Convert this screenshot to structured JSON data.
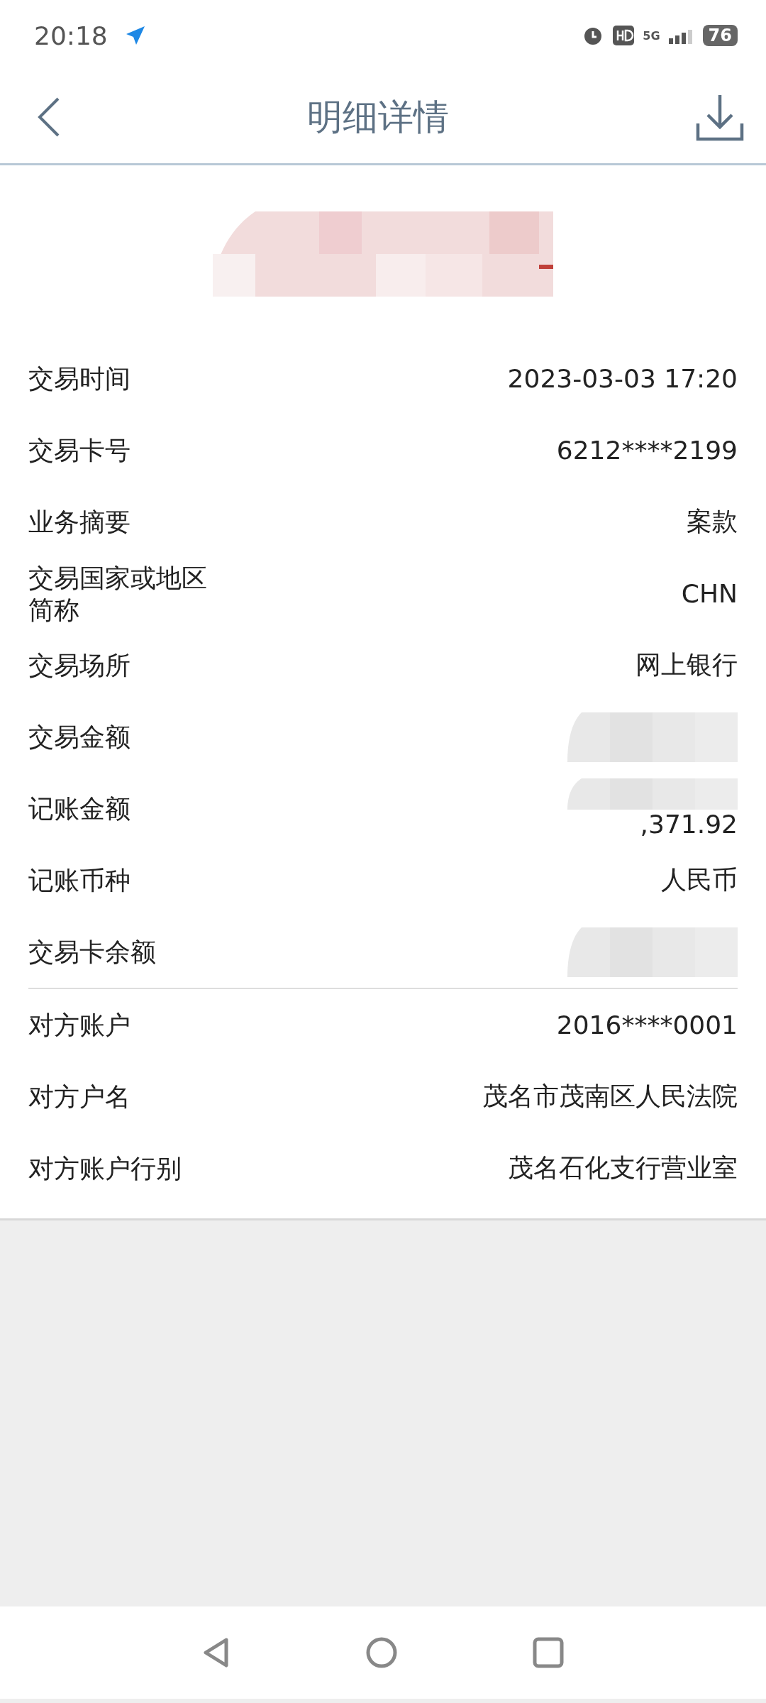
{
  "status_bar": {
    "time": "20:18",
    "battery": "76",
    "network": "5G"
  },
  "header": {
    "title": "明细详情"
  },
  "details": [
    {
      "label": "交易时间",
      "value": "2023-03-03 17:20"
    },
    {
      "label": "交易卡号",
      "value": "6212****2199"
    },
    {
      "label": "业务摘要",
      "value": "案款"
    },
    {
      "label": "交易国家或地区简称",
      "value": "CHN"
    },
    {
      "label": "交易场所",
      "value": "网上银行"
    },
    {
      "label": "交易金额",
      "redacted": true
    },
    {
      "label": "记账金额",
      "value": ",371.92",
      "redacted": true
    },
    {
      "label": "记账币种",
      "value": "人民币"
    },
    {
      "label": "交易卡余额",
      "redacted": true
    }
  ],
  "counterparty": [
    {
      "label": "对方账户",
      "value": "2016****0001"
    },
    {
      "label": "对方户名",
      "value": "茂名市茂南区人民法院"
    },
    {
      "label": "对方账户行别",
      "value": "茂名石化支行营业室"
    }
  ]
}
